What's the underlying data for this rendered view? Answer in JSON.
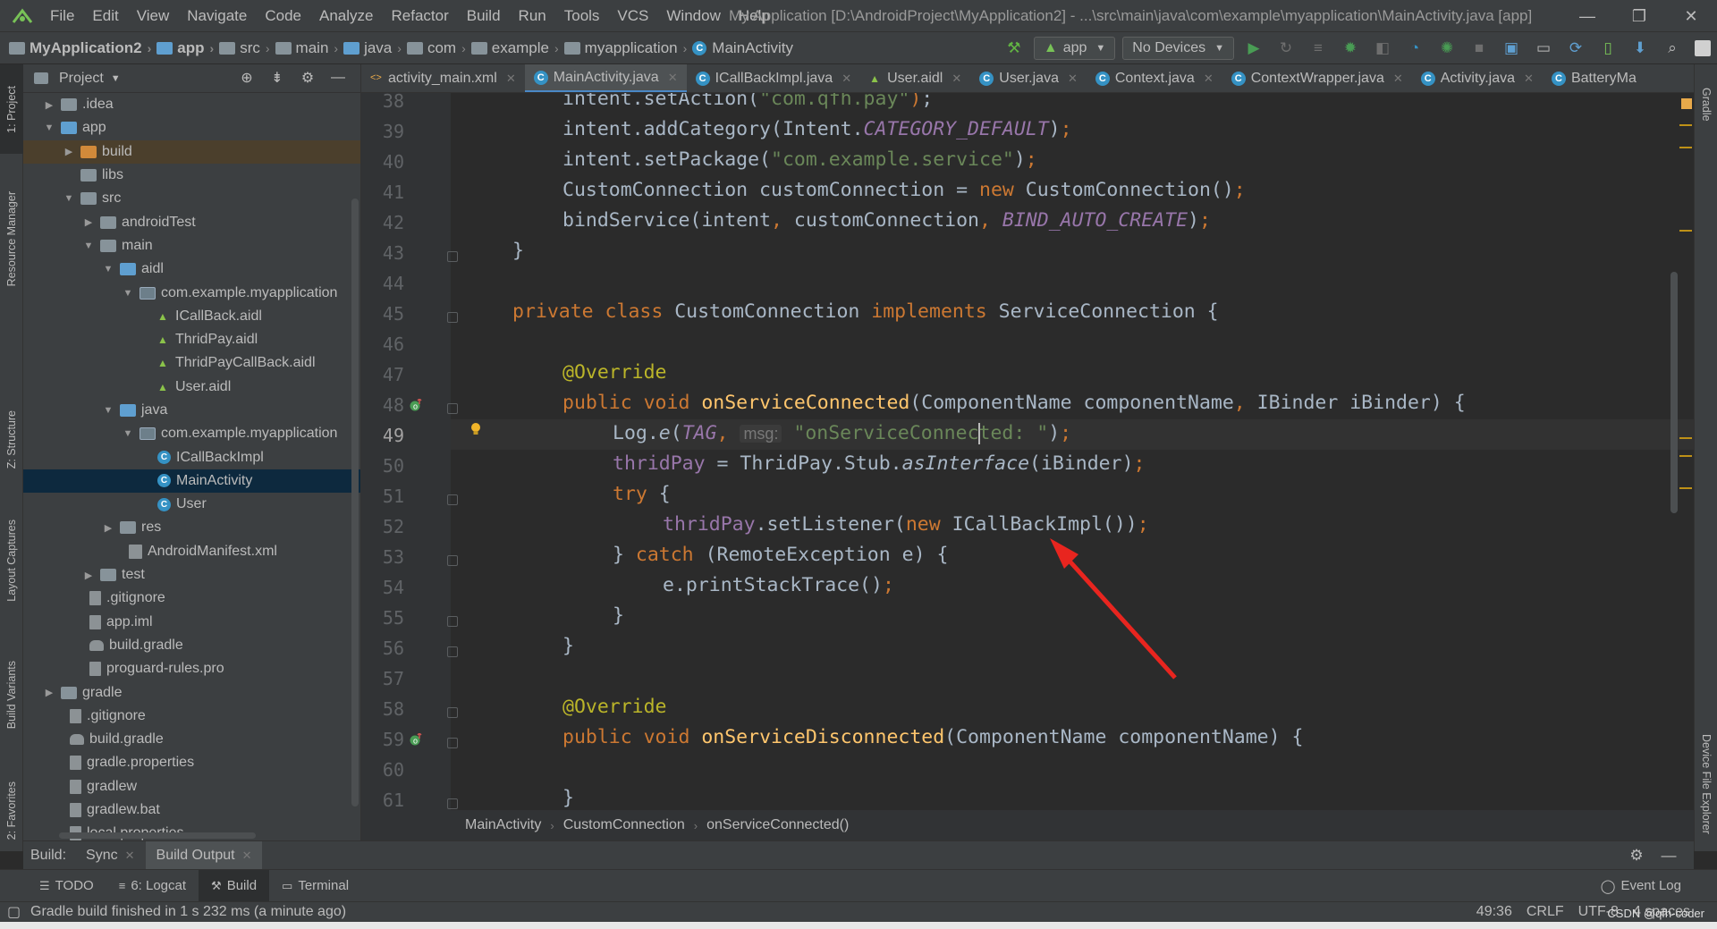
{
  "window": {
    "title": "My Application [D:\\AndroidProject\\MyApplication2] - ...\\src\\main\\java\\com\\example\\myapplication\\MainActivity.java [app]",
    "menu": [
      "File",
      "Edit",
      "View",
      "Navigate",
      "Code",
      "Analyze",
      "Refactor",
      "Build",
      "Run",
      "Tools",
      "VCS",
      "Window",
      "Help"
    ]
  },
  "nav": {
    "crumbs": [
      "MyApplication2",
      "app",
      "src",
      "main",
      "java",
      "com",
      "example",
      "myapplication",
      "MainActivity"
    ],
    "run_config": "app",
    "device": "No Devices"
  },
  "side_tabs": {
    "left": [
      "1: Project",
      "Resource Manager",
      "Z: Structure",
      "Layout Captures",
      "Build Variants",
      "2: Favorites"
    ],
    "right": [
      "Gradle",
      "Device File Explorer"
    ]
  },
  "project": {
    "title": "Project",
    "tree": [
      {
        "label": ".idea"
      },
      {
        "label": "app"
      },
      {
        "label": "build"
      },
      {
        "label": "libs"
      },
      {
        "label": "src"
      },
      {
        "label": "androidTest"
      },
      {
        "label": "main"
      },
      {
        "label": "aidl"
      },
      {
        "label": "com.example.myapplication"
      },
      {
        "label": "ICallBack.aidl"
      },
      {
        "label": "ThridPay.aidl"
      },
      {
        "label": "ThridPayCallBack.aidl"
      },
      {
        "label": "User.aidl"
      },
      {
        "label": "java"
      },
      {
        "label": "com.example.myapplication"
      },
      {
        "label": "ICallBackImpl"
      },
      {
        "label": "MainActivity"
      },
      {
        "label": "User"
      },
      {
        "label": "res"
      },
      {
        "label": "AndroidManifest.xml"
      },
      {
        "label": "test"
      },
      {
        "label": ".gitignore"
      },
      {
        "label": "app.iml"
      },
      {
        "label": "build.gradle"
      },
      {
        "label": "proguard-rules.pro"
      },
      {
        "label": "gradle"
      },
      {
        "label": ".gitignore"
      },
      {
        "label": "build.gradle"
      },
      {
        "label": "gradle.properties"
      },
      {
        "label": "gradlew"
      },
      {
        "label": "gradlew.bat"
      },
      {
        "label": "local.properties"
      }
    ]
  },
  "tabs": [
    "activity_main.xml",
    "MainActivity.java",
    "ICallBackImpl.java",
    "User.aidl",
    "User.java",
    "Context.java",
    "ContextWrapper.java",
    "Activity.java",
    "BatteryMa"
  ],
  "editor": {
    "line_numbers": [
      "38",
      "39",
      "40",
      "41",
      "42",
      "43",
      "44",
      "45",
      "46",
      "47",
      "48",
      "49",
      "50",
      "51",
      "52",
      "53",
      "54",
      "55",
      "56",
      "57",
      "58",
      "59",
      "60",
      "61"
    ],
    "current_line": "49",
    "hint": "msg:",
    "str_pay": "\"com.qfh.pay\"",
    "str_service": "\"com.example.service\"",
    "str_connected": "\"onServiceConnected: \""
  },
  "breadcrumb": [
    "MainActivity",
    "CustomConnection",
    "onServiceConnected()"
  ],
  "build_panel": {
    "label": "Build:",
    "tabs": [
      "Sync",
      "Build Output"
    ]
  },
  "tool_windows": [
    "TODO",
    "6: Logcat",
    "Build",
    "Terminal"
  ],
  "event_log": "Event Log",
  "status": {
    "message": "Gradle build finished in 1 s 232 ms (a minute ago)",
    "position": "49:36",
    "line_sep": "CRLF",
    "encoding": "UTF-8",
    "indent": "4 spaces"
  },
  "watermark": "CSDN @qfh-coder",
  "colors": {
    "keyword": "#cc7832",
    "string": "#6a8759",
    "constant": "#9876aa",
    "function": "#ffc66d",
    "annotation": "#bbb529",
    "arrow": "#e8251f"
  }
}
